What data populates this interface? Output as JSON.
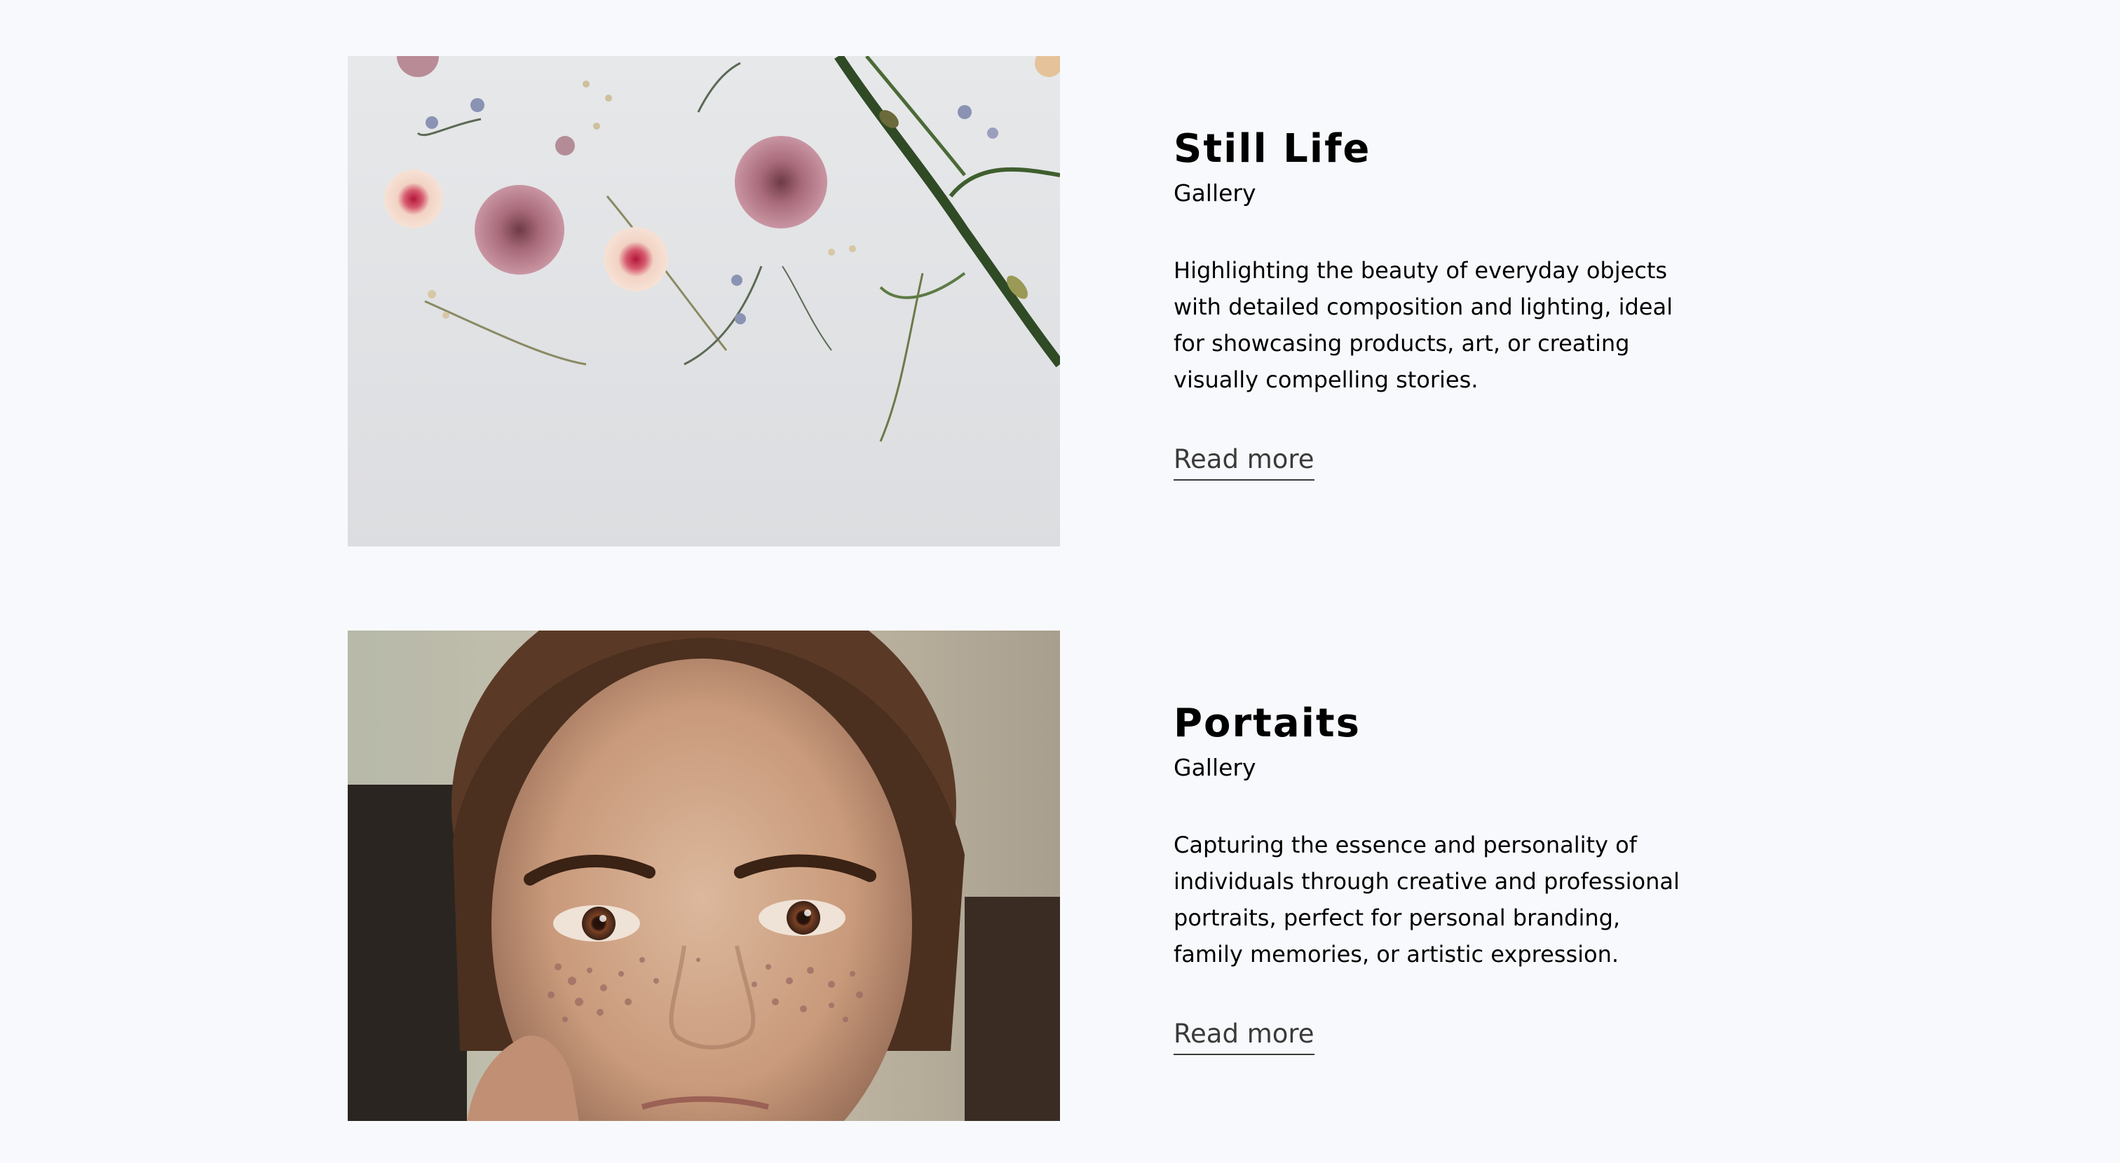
{
  "gallery": {
    "items": [
      {
        "title": "Still Life",
        "subtitle": "Gallery",
        "description": "Highlighting the beauty of everyday objects with detailed composition and lighting, ideal for showcasing products, art, or creating visually compelling stories.",
        "link_label": "Read more",
        "image": "still-life-flowers-photo"
      },
      {
        "title": "Portaits",
        "subtitle": "Gallery",
        "description": "Capturing the essence and personality of individuals through creative and professional portraits, perfect for personal branding, family memories, or artistic expression.",
        "link_label": "Read more",
        "image": "freckled-woman-portrait-photo"
      }
    ]
  },
  "colors": {
    "background": "#f8f9fc",
    "text": "#000000",
    "link": "#3a3a3a"
  }
}
